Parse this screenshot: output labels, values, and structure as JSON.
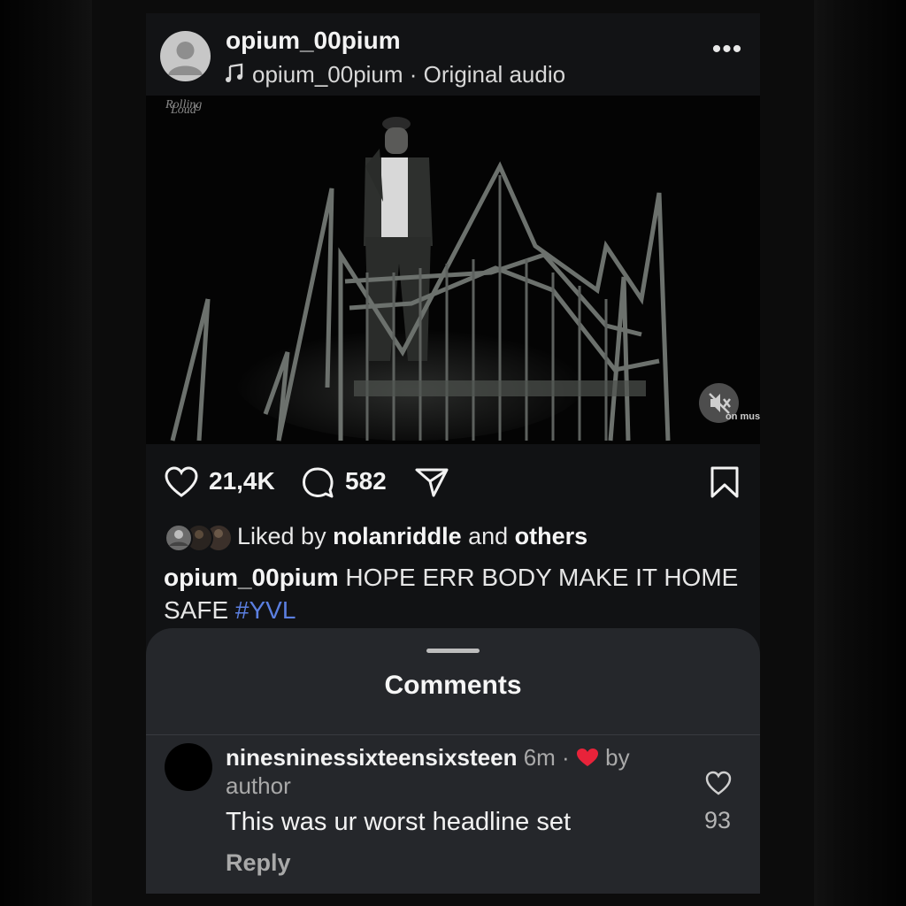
{
  "post": {
    "username": "opium_00pium",
    "audio": "opium_00pium · Original audio",
    "more": "•••",
    "media_watermark": "on mus"
  },
  "actions": {
    "likes": "21,4K",
    "comments": "582"
  },
  "liked_by": {
    "prefix": "Liked by ",
    "user": "nolanriddle",
    "middle": " and ",
    "suffix": "others"
  },
  "caption": {
    "user": "opium_00pium",
    "text": " HOPE ERR BODY MAKE IT HOME SAFE ",
    "hashtag": "#YVL"
  },
  "comments_sheet": {
    "title": "Comments",
    "items": [
      {
        "username": "ninesninessixteensixsteen",
        "time": " 6m",
        "separator": " · ",
        "by": " by",
        "by_line2": "author",
        "text": "This was ur worst headline set",
        "reply": "Reply",
        "like_count": "93"
      }
    ]
  },
  "colors": {
    "hashtag": "#5b7fe0",
    "heart": "#e8233a",
    "sheet_bg": "#25272b",
    "card_bg": "#111214"
  },
  "icons": [
    "music-note-icon",
    "more-icon",
    "mute-icon",
    "heart-icon",
    "comment-icon",
    "share-icon",
    "bookmark-icon",
    "like-heart-icon"
  ]
}
